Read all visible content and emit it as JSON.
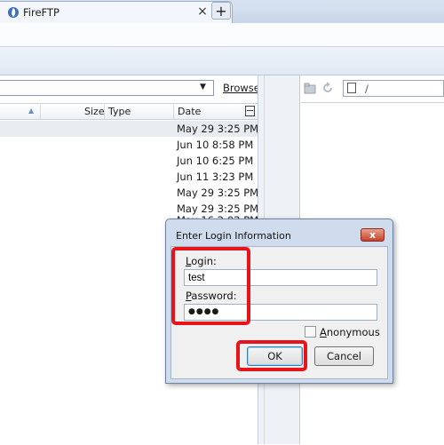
{
  "tab": {
    "title": "FireFTP",
    "close_glyph": "×",
    "new_tab_glyph": "+"
  },
  "local": {
    "browse_label": "Browse",
    "columns": {
      "size": "Size",
      "type": "Type",
      "date": "Date"
    },
    "rows": [
      {
        "date": "May 29 3:25 PM"
      },
      {
        "date": "Jun 10 8:58 PM"
      },
      {
        "date": "Jun 10 6:25 PM"
      },
      {
        "date": "Jun 11 3:23 PM"
      },
      {
        "date": "May 29 3:25 PM"
      },
      {
        "date": "May 29 3:25 PM"
      },
      {
        "date": "May 16 2:02 PM"
      }
    ]
  },
  "remote": {
    "path": "/"
  },
  "dialog": {
    "title": "Enter Login Information",
    "close_glyph": "x",
    "login_label": "Login:",
    "login_value": "test",
    "password_label": "Password:",
    "password_value": "●●●●",
    "anonymous_label": "Anonymous",
    "ok_label": "OK",
    "cancel_label": "Cancel"
  },
  "colors": {
    "highlight": "#e8141b",
    "dialog_frame": "#cfdced",
    "close_button": "#c7412b"
  }
}
